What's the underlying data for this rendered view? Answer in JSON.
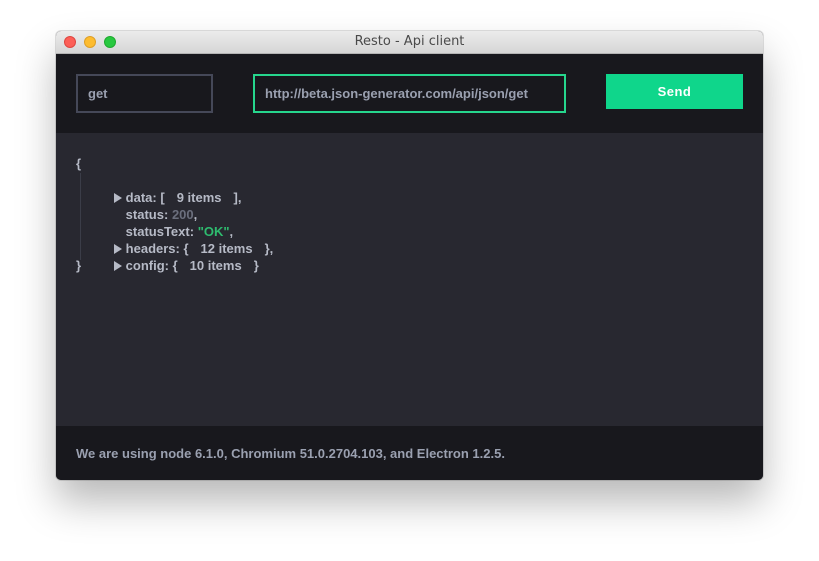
{
  "window": {
    "title": "Resto - Api client"
  },
  "request": {
    "method": "get",
    "url": "http://beta.json-generator.com/api/json/get",
    "send_label": "Send"
  },
  "response": {
    "open_brace": "{",
    "close_brace": "}",
    "fields": [
      {
        "key": "data",
        "sep": ": [",
        "count": "9 items",
        "end": "],",
        "collapsible": true
      },
      {
        "key": "status",
        "sep": ":",
        "value": "200",
        "end": ",",
        "collapsible": false
      },
      {
        "key": "statusText",
        "sep": ":",
        "value": "\"OK\"",
        "end": ",",
        "collapsible": false
      },
      {
        "key": "headers",
        "sep": ": {",
        "count": "12 items",
        "end": "},",
        "collapsible": true
      },
      {
        "key": "config",
        "sep": ": {",
        "count": "10 items",
        "end": "}",
        "collapsible": true
      }
    ]
  },
  "footer": {
    "info": "We are using node 6.1.0, Chromium 51.0.2704.103, and Electron 1.2.5."
  },
  "colors": {
    "accent": "#0fd68b",
    "string": "#2ebc6f",
    "number": "#6b6f7d",
    "background": "#282830",
    "toolbar": "#18181d"
  }
}
